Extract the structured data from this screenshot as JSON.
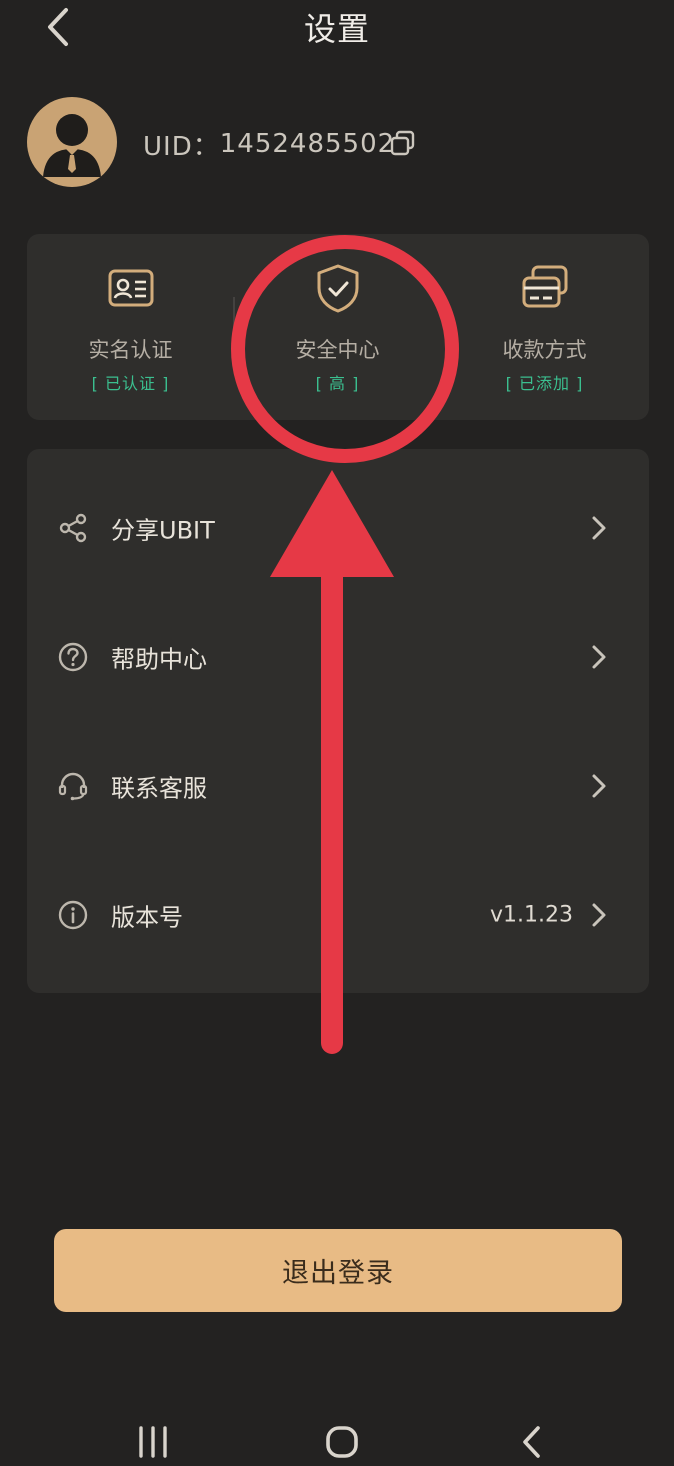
{
  "header": {
    "title": "设置",
    "back_icon": "chevron-left-icon"
  },
  "profile": {
    "uid_label": "UID：",
    "uid_value": "1452485502",
    "avatar_icon": "user-avatar-icon",
    "copy_icon": "copy-icon"
  },
  "features": [
    {
      "label": "实名认证",
      "status": "[ 已认证 ]",
      "icon": "id-card-icon"
    },
    {
      "label": "安全中心",
      "status": "[ 高 ]",
      "icon": "shield-check-icon"
    },
    {
      "label": "收款方式",
      "status": "[ 已添加 ]",
      "icon": "cards-icon"
    }
  ],
  "menu": [
    {
      "label": "分享UBIT",
      "value": "",
      "icon": "share-icon"
    },
    {
      "label": "帮助中心",
      "value": "",
      "icon": "help-icon"
    },
    {
      "label": "联系客服",
      "value": "",
      "icon": "headset-icon"
    },
    {
      "label": "版本号",
      "value": "v1.1.23",
      "icon": "info-icon"
    }
  ],
  "logout": {
    "label": "退出登录"
  },
  "system_nav": {
    "recent": "recent-apps-icon",
    "home": "home-icon",
    "back": "back-icon"
  },
  "colors": {
    "background": "#232221",
    "card": "#2f2e2c",
    "accent_gold": "#e8bb85",
    "status_green": "#3bbf8f",
    "annotation_red": "#e63946"
  }
}
